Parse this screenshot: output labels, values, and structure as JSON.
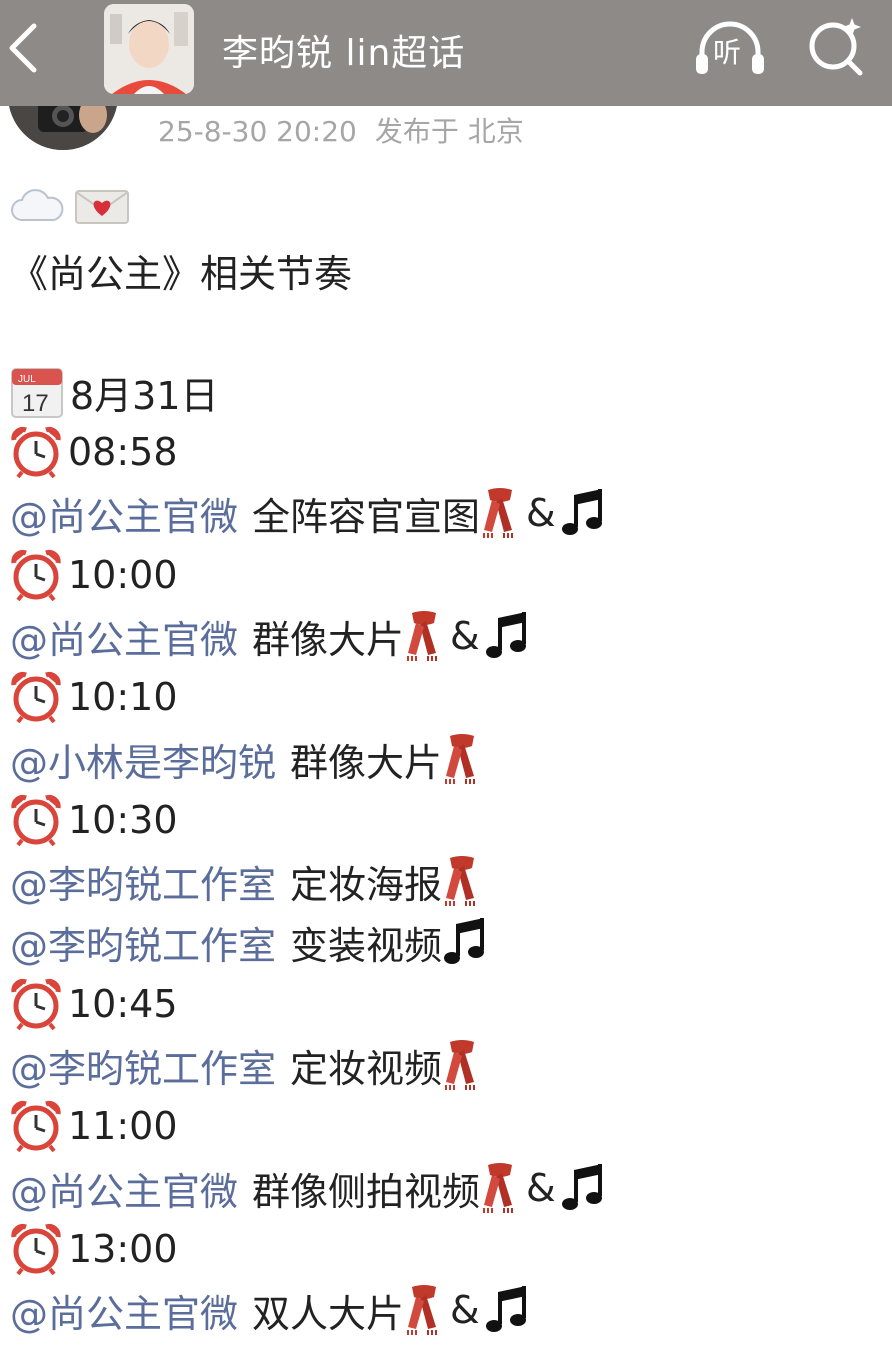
{
  "header": {
    "title": "李昀锐 lin超话",
    "listen_label": "听"
  },
  "post": {
    "timestamp": "25-8-30 20:20",
    "location": "发布于 北京",
    "emojis": [
      "cloud-icon",
      "love-letter-icon"
    ],
    "title": "《尚公主》相关节奏",
    "date": "8月31日",
    "schedule": [
      {
        "type": "time",
        "text": "08:58"
      },
      {
        "type": "mention",
        "mention": "@尚公主官微",
        "text": "全阵容官宣图",
        "icons": [
          "scarf-icon",
          "amp",
          "music-note-icon"
        ]
      },
      {
        "type": "time",
        "text": "10:00"
      },
      {
        "type": "mention",
        "mention": "@尚公主官微",
        "text": "群像大片",
        "icons": [
          "scarf-icon",
          "amp",
          "music-note-icon"
        ]
      },
      {
        "type": "time",
        "text": "10:10"
      },
      {
        "type": "mention",
        "mention": "@小林是李昀锐",
        "text": "群像大片",
        "icons": [
          "scarf-icon"
        ]
      },
      {
        "type": "time",
        "text": "10:30"
      },
      {
        "type": "mention",
        "mention": "@李昀锐工作室",
        "text": "定妆海报",
        "icons": [
          "scarf-icon"
        ]
      },
      {
        "type": "mention",
        "mention": "@李昀锐工作室",
        "text": "变装视频",
        "icons": [
          "music-note-icon"
        ]
      },
      {
        "type": "time",
        "text": "10:45"
      },
      {
        "type": "mention",
        "mention": "@李昀锐工作室",
        "text": "定妆视频",
        "icons": [
          "scarf-icon"
        ]
      },
      {
        "type": "time",
        "text": "11:00"
      },
      {
        "type": "mention",
        "mention": "@尚公主官微",
        "text": "群像侧拍视频",
        "icons": [
          "scarf-icon",
          "amp",
          "music-note-icon"
        ]
      },
      {
        "type": "time",
        "text": "13:00"
      },
      {
        "type": "mention",
        "mention": "@尚公主官微",
        "text": "双人大片",
        "icons": [
          "scarf-icon",
          "amp",
          "music-note-icon"
        ]
      }
    ],
    "amp_symbol": "&",
    "calendar_month": "JUL",
    "calendar_day": "17"
  },
  "colors": {
    "header_bg": "#8d8a88",
    "mention": "#5a6d9b",
    "meta": "#a6a6a6",
    "alarm_red": "#d9453a",
    "scarf_red": "#c0392b"
  }
}
